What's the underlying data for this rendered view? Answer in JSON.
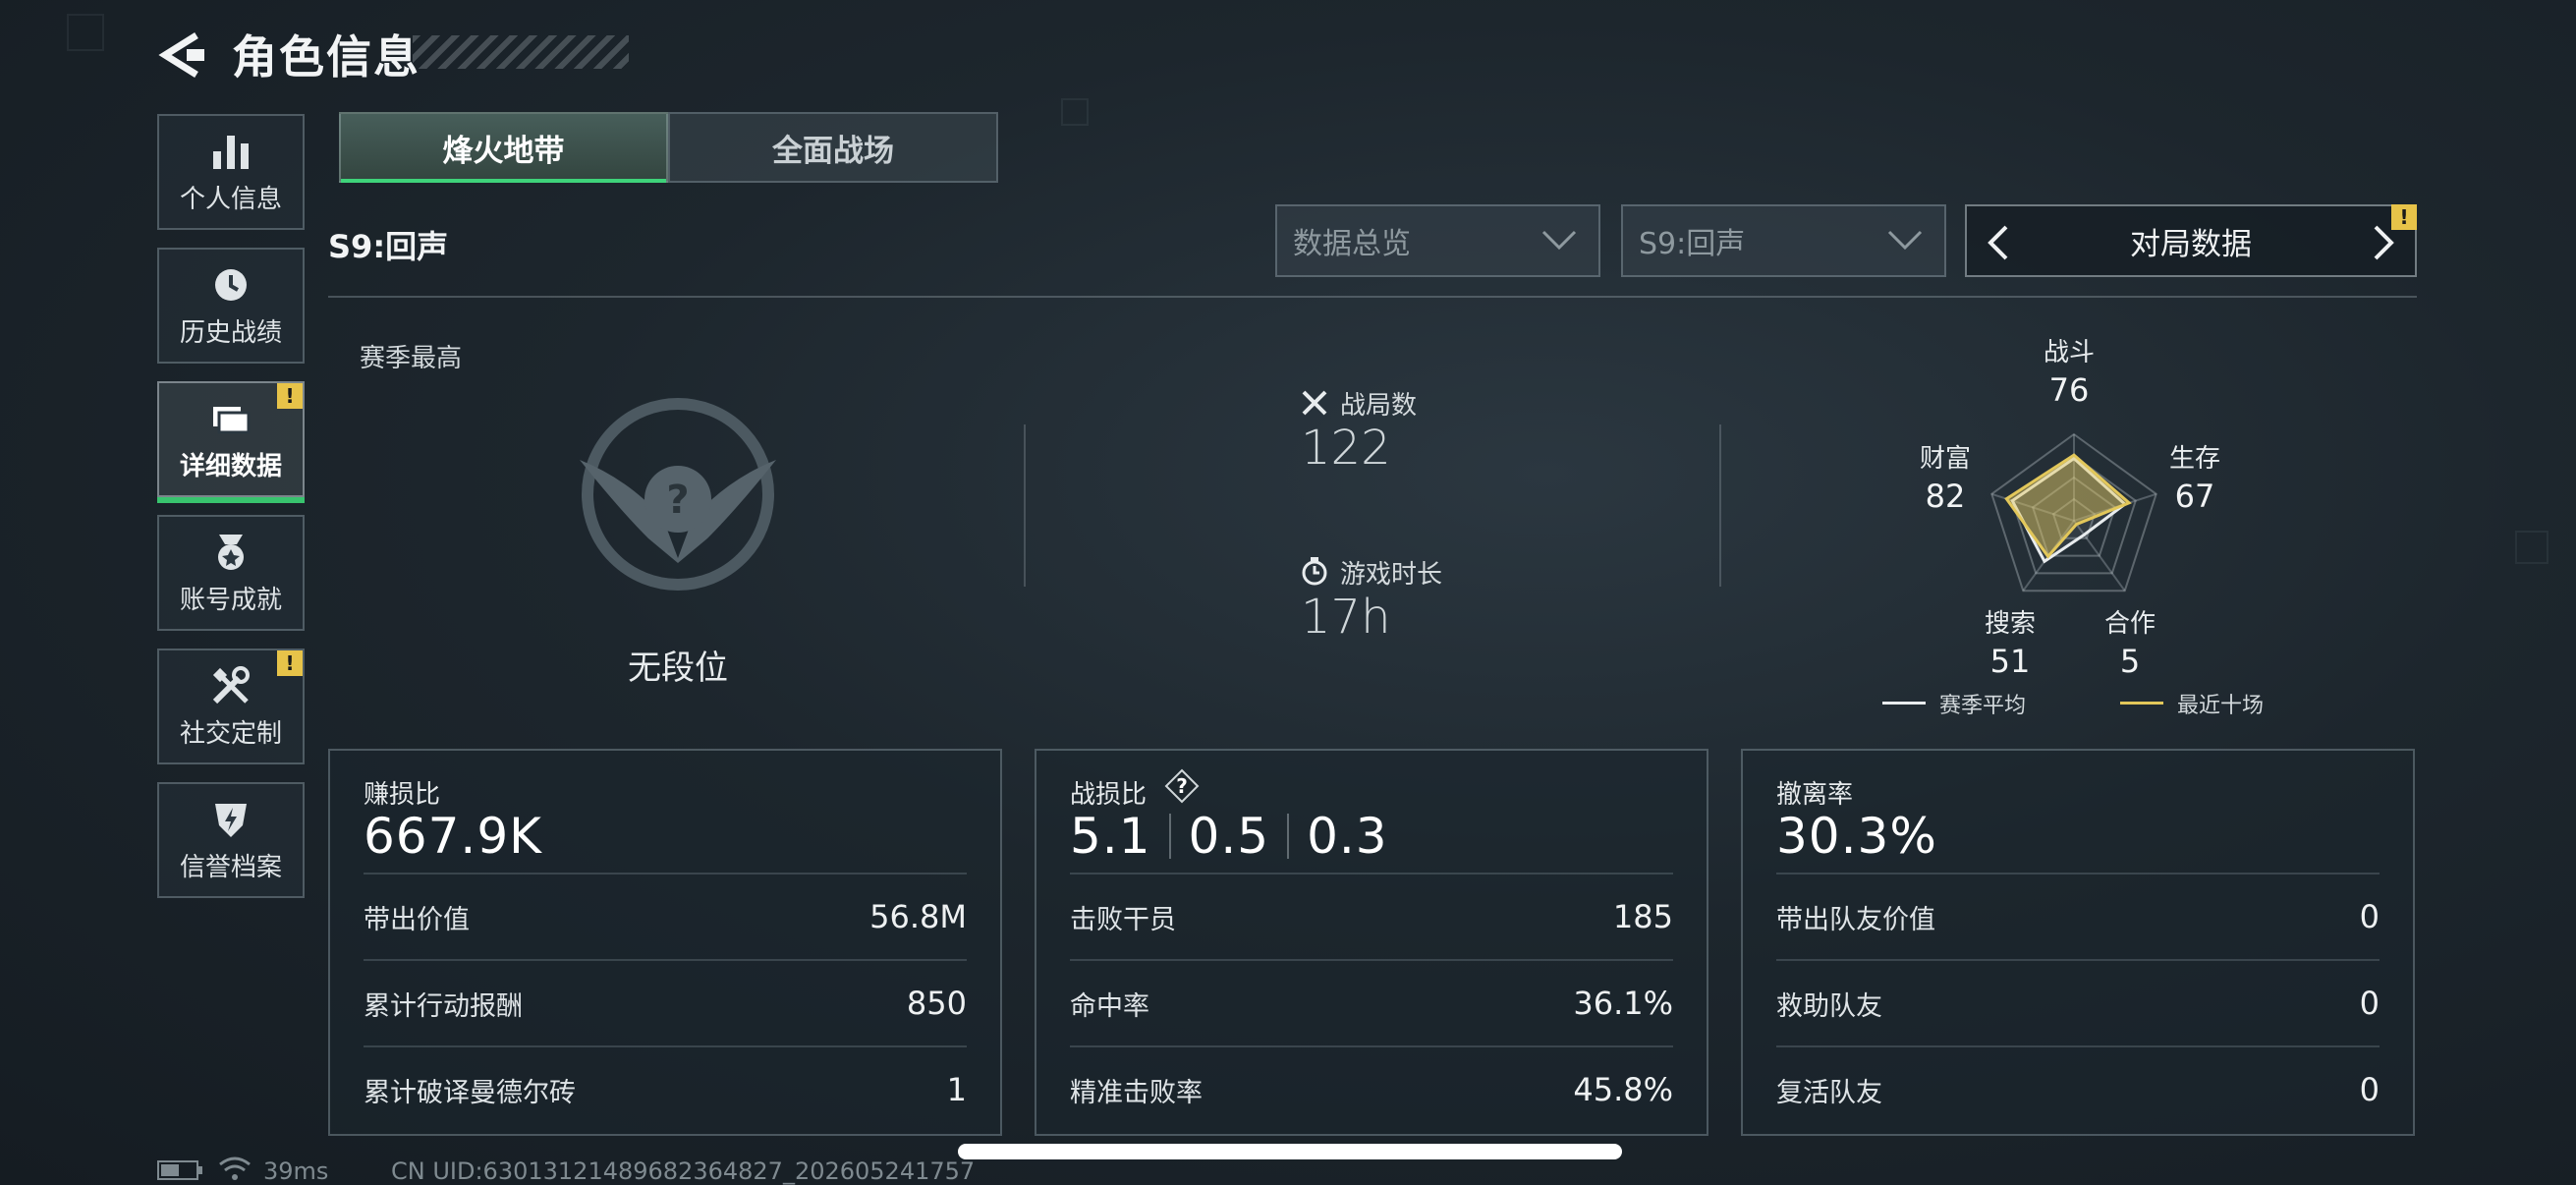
{
  "header": {
    "title": "角色信息"
  },
  "sidebar": {
    "items": [
      {
        "label": "个人信息",
        "icon": "bar-chart-icon"
      },
      {
        "label": "历史战绩",
        "icon": "history-clock-icon"
      },
      {
        "label": "详细数据",
        "icon": "folder-icon",
        "active": true,
        "badge": "!"
      },
      {
        "label": "账号成就",
        "icon": "medal-icon"
      },
      {
        "label": "社交定制",
        "icon": "tools-icon",
        "badge": "!"
      },
      {
        "label": "信誉档案",
        "icon": "shield-icon"
      }
    ]
  },
  "tabs": [
    {
      "label": "烽火地带",
      "active": true
    },
    {
      "label": "全面战场",
      "active": false
    }
  ],
  "season": "S9:回声",
  "filters": {
    "overview": "数据总览",
    "season": "S9:回声",
    "pager": "对局数据",
    "pager_badge": "!"
  },
  "rank": {
    "label": "赛季最高",
    "name": "无段位",
    "emblem_glyph": "?"
  },
  "summary": {
    "matches_label": "战局数",
    "matches_value": "122",
    "time_label": "游戏时长",
    "time_value": "17h"
  },
  "radar": {
    "axes": [
      {
        "label": "战斗",
        "value": "76"
      },
      {
        "label": "生存",
        "value": "67"
      },
      {
        "label": "合作",
        "value": "5"
      },
      {
        "label": "搜索",
        "value": "51"
      },
      {
        "label": "财富",
        "value": "82"
      }
    ],
    "season_avg": [
      0.72,
      0.62,
      0.2,
      0.58,
      0.75
    ],
    "recent": [
      0.76,
      0.67,
      0.05,
      0.51,
      0.82
    ],
    "legend_avg": "赛季平均",
    "legend_recent": "最近十场",
    "color_avg": "#e8ecee",
    "color_recent": "#e2c75a"
  },
  "cards": {
    "profit": {
      "title": "赚损比",
      "value": "667.9K",
      "rows": [
        {
          "k": "带出价值",
          "v": "56.8M"
        },
        {
          "k": "累计行动报酬",
          "v": "850"
        },
        {
          "k": "累计破译曼德尔砖",
          "v": "1"
        }
      ]
    },
    "kd": {
      "title": "战损比",
      "help": "?",
      "v1": "5.1",
      "v2": "0.5",
      "v3": "0.3",
      "rows": [
        {
          "k": "击败干员",
          "v": "185"
        },
        {
          "k": "命中率",
          "v": "36.1%"
        },
        {
          "k": "精准击败率",
          "v": "45.8%"
        }
      ]
    },
    "extract": {
      "title": "撤离率",
      "value": "30.3%",
      "rows": [
        {
          "k": "带出队友价值",
          "v": "0"
        },
        {
          "k": "救助队友",
          "v": "0"
        },
        {
          "k": "复活队友",
          "v": "0"
        }
      ]
    }
  },
  "footer": {
    "ping": "39ms",
    "uid": "CN UID:63013121489682364827_202605241757"
  }
}
